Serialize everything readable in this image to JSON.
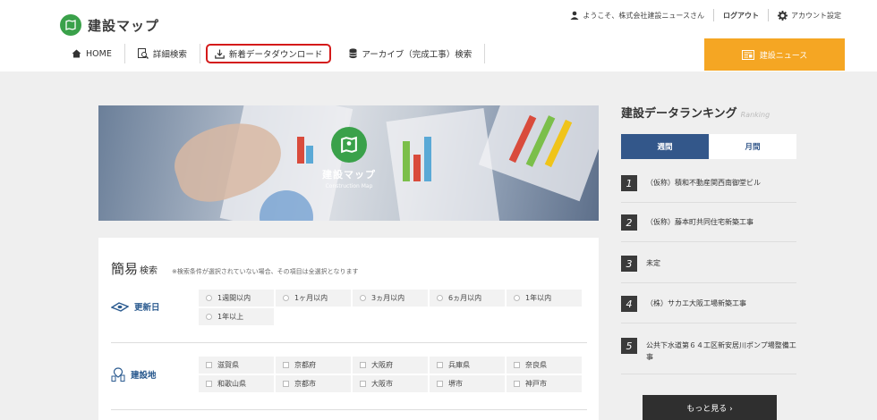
{
  "app": {
    "logo_text": "建設マップ"
  },
  "topbar": {
    "welcome": "ようこそ、株式会社建設ニュースさん",
    "logout": "ログアウト",
    "account": "アカウント設定"
  },
  "nav": {
    "items": [
      {
        "label": "HOME",
        "icon": "home-icon"
      },
      {
        "label": "詳細検索",
        "icon": "detail-search-icon"
      },
      {
        "label": "新着データダウンロード",
        "icon": "download-icon"
      },
      {
        "label": "アーカイブ（完成工事）検索",
        "icon": "database-icon"
      }
    ],
    "news_button": "建設ニュース"
  },
  "hero": {
    "title": "建設マップ",
    "subtitle": "Construction Map"
  },
  "search": {
    "title": "簡易",
    "title_small": "検索",
    "note": "※検索条件が選択されていない場合、その項目は全選択となります",
    "update": {
      "label": "更新日",
      "options": [
        "1週間以内",
        "1ヶ月以内",
        "3ヵ月以内",
        "6ヵ月以内",
        "1年以内",
        "1年以上"
      ]
    },
    "location": {
      "label": "建設地",
      "options": [
        "滋賀県",
        "京都府",
        "大阪府",
        "兵庫県",
        "奈良県",
        "和歌山県",
        "京都市",
        "大阪市",
        "堺市",
        "神戸市"
      ]
    }
  },
  "ranking": {
    "title": "建設データランキング",
    "subtitle": "Ranking",
    "tabs": [
      "週間",
      "月間"
    ],
    "items": [
      {
        "num": "1",
        "text": "（仮称）積和不動産関西南御堂ビル"
      },
      {
        "num": "2",
        "text": "（仮称）藤本町共同住宅新築工事"
      },
      {
        "num": "3",
        "text": "未定"
      },
      {
        "num": "4",
        "text": "（株）サカエ大阪工場新築工事"
      },
      {
        "num": "5",
        "text": "公共下水道第６４工区新安居川ポンプ場整備工事"
      }
    ],
    "more": "もっと見る ›"
  },
  "colors": {
    "brand_green": "#3aa14a",
    "news_orange": "#f5a623",
    "tab_blue": "#33578a",
    "highlight_red": "#d41a1a"
  }
}
